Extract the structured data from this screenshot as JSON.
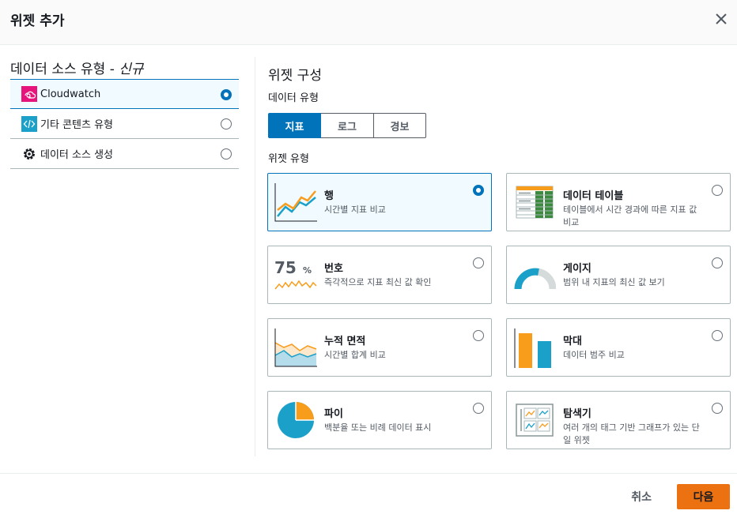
{
  "modal": {
    "title": "위젯 추가"
  },
  "data_source": {
    "title": "데이터 소스 유형 - ",
    "title_new": "신규",
    "items": [
      {
        "label": "Cloudwatch",
        "icon": "cloudwatch-icon",
        "selected": true
      },
      {
        "label": "기타 콘텐츠 유형",
        "icon": "code-icon",
        "selected": false
      },
      {
        "label": "데이터 소스 생성",
        "icon": "gear-icon",
        "selected": false
      }
    ]
  },
  "widget_config": {
    "title": "위젯 구성",
    "data_type_label": "데이터 유형",
    "data_types": [
      "지표",
      "로그",
      "경보"
    ],
    "active_data_type": "지표",
    "widget_type_label": "위젯 유형",
    "widgets": [
      {
        "title": "행",
        "desc": "시간별 지표 비교",
        "icon": "line-chart-icon",
        "selected": true
      },
      {
        "title": "데이터 테이블",
        "desc": "테이블에서 시간 경과에 따른 지표 값 비교",
        "icon": "data-table-icon",
        "selected": false
      },
      {
        "title": "번호",
        "desc": "즉각적으로 지표 최신 값 확인",
        "icon": "number-icon",
        "thumb_text": "75",
        "thumb_unit": "%",
        "selected": false
      },
      {
        "title": "게이지",
        "desc": "범위 내 지표의 최신 값 보기",
        "icon": "gauge-icon",
        "selected": false
      },
      {
        "title": "누적 면적",
        "desc": "시간별 합계 비교",
        "icon": "stacked-area-icon",
        "selected": false
      },
      {
        "title": "막대",
        "desc": "데이터 범주 비교",
        "icon": "bar-chart-icon",
        "selected": false
      },
      {
        "title": "파이",
        "desc": "백분율 또는 비례 데이터 표시",
        "icon": "pie-chart-icon",
        "selected": false
      },
      {
        "title": "탐색기",
        "desc": "여러 개의 태그 기반 그래프가 있는 단일 위젯",
        "icon": "explorer-icon",
        "selected": false
      }
    ]
  },
  "footer": {
    "cancel_label": "취소",
    "next_label": "다음"
  },
  "colors": {
    "accent": "#0073bb",
    "primary_button": "#ec7211",
    "orange": "#f89c1c",
    "blue": "#1ba1c9"
  }
}
